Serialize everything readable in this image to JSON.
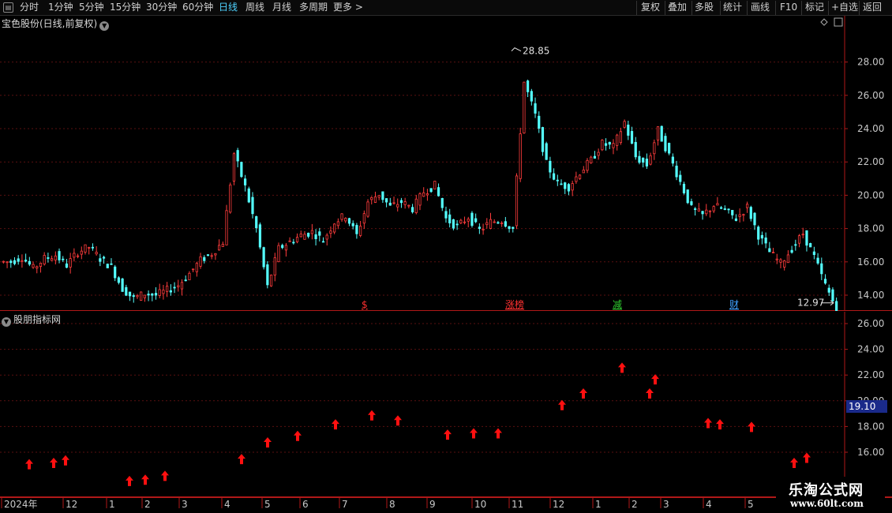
{
  "toolbar": {
    "periods": [
      "分时",
      "1分钟",
      "5分钟",
      "15分钟",
      "30分钟",
      "60分钟",
      "日线",
      "周线",
      "月线",
      "多周期",
      "更多"
    ],
    "active_period": "日线",
    "right_buttons": [
      "复权",
      "叠加",
      "多股",
      "统计",
      "画线",
      "F10",
      "标记",
      "+自选",
      "返回"
    ]
  },
  "main_panel": {
    "title": "宝色股份(日线,前复权)",
    "high_label": "28.85",
    "low_label": "12.97",
    "event_markers": [
      {
        "label": "$",
        "color": "#ff3030"
      },
      {
        "label": "涨榜",
        "color": "#ff3030"
      },
      {
        "label": "减",
        "color": "#30d030"
      },
      {
        "label": "财",
        "color": "#40a0ff"
      }
    ]
  },
  "indicator_panel": {
    "title": "股朋指标网",
    "current_value": "19.10"
  },
  "chart_data": {
    "type": "candlestick",
    "y_ticks_main": [
      "28.00",
      "26.00",
      "24.00",
      "22.00",
      "20.00",
      "18.00",
      "16.00",
      "14.00"
    ],
    "y_ticks_indicator": [
      "26.00",
      "24.00",
      "22.00",
      "20.00",
      "18.00",
      "16.00"
    ],
    "x_ticks": [
      "2024年",
      "12",
      "1",
      "2",
      "3",
      "4",
      "5",
      "6",
      "7",
      "8",
      "9",
      "10",
      "11",
      "12",
      "1",
      "2",
      "3",
      "4",
      "5"
    ],
    "close_series": [
      16.0,
      16.3,
      15.6,
      16.2,
      16.4,
      15.8,
      16.6,
      16.9,
      16.2,
      15.7,
      14.4,
      13.8,
      14.1,
      14.0,
      14.3,
      14.6,
      15.3,
      16.1,
      16.5,
      17.2,
      22.5,
      20.5,
      18.0,
      14.5,
      16.8,
      17.2,
      17.6,
      17.8,
      17.3,
      18.4,
      18.8,
      17.6,
      19.6,
      20.1,
      19.3,
      19.6,
      19.2,
      20.2,
      20.6,
      18.6,
      18.1,
      18.7,
      17.9,
      18.4,
      18.5,
      18.0,
      26.8,
      24.8,
      21.9,
      20.7,
      20.5,
      21.4,
      22.1,
      23.1,
      22.9,
      24.4,
      22.3,
      21.8,
      23.9,
      22.4,
      20.8,
      19.2,
      18.8,
      19.4,
      19.1,
      18.6,
      19.3,
      17.6,
      16.6,
      15.9,
      16.8,
      17.7,
      16.3,
      14.6,
      13.2
    ],
    "indicator_arrows": [
      15.1,
      15.2,
      15.4,
      13.8,
      13.9,
      14.2,
      15.5,
      16.8,
      17.3,
      18.2,
      18.9,
      18.5,
      17.4,
      17.5,
      17.5,
      19.7,
      20.6,
      22.6,
      20.6,
      21.7,
      18.3,
      18.2,
      18.0,
      15.2,
      15.6
    ],
    "ylim_main": [
      13.0,
      29.0
    ],
    "ylim_indicator": [
      14.5,
      26.5
    ]
  },
  "watermark": {
    "title": "乐淘公式网",
    "url": "www.60lt.com"
  }
}
